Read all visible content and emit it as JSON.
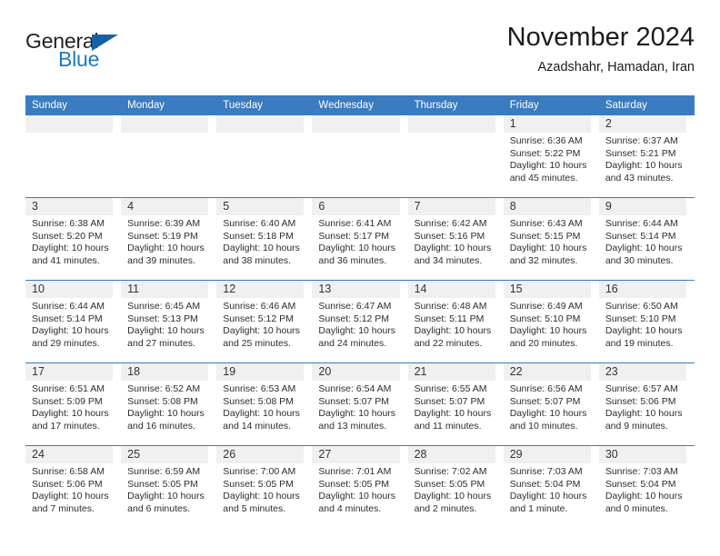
{
  "brand": {
    "name_top": "General",
    "name_bottom": "Blue",
    "triangle_icon": "triangle-icon",
    "color_black": "#231f20",
    "color_blue": "#1b7ac9"
  },
  "header": {
    "title": "November 2024",
    "subtitle": "Azadshahr, Hamadan, Iran"
  },
  "theme": {
    "header_blue": "#3b7bbf",
    "daynum_strip": "#f0f0f0",
    "text": "#2d2d2d"
  },
  "calendar": {
    "weekday_headers": [
      "Sunday",
      "Monday",
      "Tuesday",
      "Wednesday",
      "Thursday",
      "Friday",
      "Saturday"
    ],
    "weeks": [
      [
        {
          "day": "",
          "sunrise": "",
          "sunset": "",
          "daylight_line1": "",
          "daylight_line2": ""
        },
        {
          "day": "",
          "sunrise": "",
          "sunset": "",
          "daylight_line1": "",
          "daylight_line2": ""
        },
        {
          "day": "",
          "sunrise": "",
          "sunset": "",
          "daylight_line1": "",
          "daylight_line2": ""
        },
        {
          "day": "",
          "sunrise": "",
          "sunset": "",
          "daylight_line1": "",
          "daylight_line2": ""
        },
        {
          "day": "",
          "sunrise": "",
          "sunset": "",
          "daylight_line1": "",
          "daylight_line2": ""
        },
        {
          "day": "1",
          "sunrise": "Sunrise: 6:36 AM",
          "sunset": "Sunset: 5:22 PM",
          "daylight_line1": "Daylight: 10 hours",
          "daylight_line2": "and 45 minutes."
        },
        {
          "day": "2",
          "sunrise": "Sunrise: 6:37 AM",
          "sunset": "Sunset: 5:21 PM",
          "daylight_line1": "Daylight: 10 hours",
          "daylight_line2": "and 43 minutes."
        }
      ],
      [
        {
          "day": "3",
          "sunrise": "Sunrise: 6:38 AM",
          "sunset": "Sunset: 5:20 PM",
          "daylight_line1": "Daylight: 10 hours",
          "daylight_line2": "and 41 minutes."
        },
        {
          "day": "4",
          "sunrise": "Sunrise: 6:39 AM",
          "sunset": "Sunset: 5:19 PM",
          "daylight_line1": "Daylight: 10 hours",
          "daylight_line2": "and 39 minutes."
        },
        {
          "day": "5",
          "sunrise": "Sunrise: 6:40 AM",
          "sunset": "Sunset: 5:18 PM",
          "daylight_line1": "Daylight: 10 hours",
          "daylight_line2": "and 38 minutes."
        },
        {
          "day": "6",
          "sunrise": "Sunrise: 6:41 AM",
          "sunset": "Sunset: 5:17 PM",
          "daylight_line1": "Daylight: 10 hours",
          "daylight_line2": "and 36 minutes."
        },
        {
          "day": "7",
          "sunrise": "Sunrise: 6:42 AM",
          "sunset": "Sunset: 5:16 PM",
          "daylight_line1": "Daylight: 10 hours",
          "daylight_line2": "and 34 minutes."
        },
        {
          "day": "8",
          "sunrise": "Sunrise: 6:43 AM",
          "sunset": "Sunset: 5:15 PM",
          "daylight_line1": "Daylight: 10 hours",
          "daylight_line2": "and 32 minutes."
        },
        {
          "day": "9",
          "sunrise": "Sunrise: 6:44 AM",
          "sunset": "Sunset: 5:14 PM",
          "daylight_line1": "Daylight: 10 hours",
          "daylight_line2": "and 30 minutes."
        }
      ],
      [
        {
          "day": "10",
          "sunrise": "Sunrise: 6:44 AM",
          "sunset": "Sunset: 5:14 PM",
          "daylight_line1": "Daylight: 10 hours",
          "daylight_line2": "and 29 minutes."
        },
        {
          "day": "11",
          "sunrise": "Sunrise: 6:45 AM",
          "sunset": "Sunset: 5:13 PM",
          "daylight_line1": "Daylight: 10 hours",
          "daylight_line2": "and 27 minutes."
        },
        {
          "day": "12",
          "sunrise": "Sunrise: 6:46 AM",
          "sunset": "Sunset: 5:12 PM",
          "daylight_line1": "Daylight: 10 hours",
          "daylight_line2": "and 25 minutes."
        },
        {
          "day": "13",
          "sunrise": "Sunrise: 6:47 AM",
          "sunset": "Sunset: 5:12 PM",
          "daylight_line1": "Daylight: 10 hours",
          "daylight_line2": "and 24 minutes."
        },
        {
          "day": "14",
          "sunrise": "Sunrise: 6:48 AM",
          "sunset": "Sunset: 5:11 PM",
          "daylight_line1": "Daylight: 10 hours",
          "daylight_line2": "and 22 minutes."
        },
        {
          "day": "15",
          "sunrise": "Sunrise: 6:49 AM",
          "sunset": "Sunset: 5:10 PM",
          "daylight_line1": "Daylight: 10 hours",
          "daylight_line2": "and 20 minutes."
        },
        {
          "day": "16",
          "sunrise": "Sunrise: 6:50 AM",
          "sunset": "Sunset: 5:10 PM",
          "daylight_line1": "Daylight: 10 hours",
          "daylight_line2": "and 19 minutes."
        }
      ],
      [
        {
          "day": "17",
          "sunrise": "Sunrise: 6:51 AM",
          "sunset": "Sunset: 5:09 PM",
          "daylight_line1": "Daylight: 10 hours",
          "daylight_line2": "and 17 minutes."
        },
        {
          "day": "18",
          "sunrise": "Sunrise: 6:52 AM",
          "sunset": "Sunset: 5:08 PM",
          "daylight_line1": "Daylight: 10 hours",
          "daylight_line2": "and 16 minutes."
        },
        {
          "day": "19",
          "sunrise": "Sunrise: 6:53 AM",
          "sunset": "Sunset: 5:08 PM",
          "daylight_line1": "Daylight: 10 hours",
          "daylight_line2": "and 14 minutes."
        },
        {
          "day": "20",
          "sunrise": "Sunrise: 6:54 AM",
          "sunset": "Sunset: 5:07 PM",
          "daylight_line1": "Daylight: 10 hours",
          "daylight_line2": "and 13 minutes."
        },
        {
          "day": "21",
          "sunrise": "Sunrise: 6:55 AM",
          "sunset": "Sunset: 5:07 PM",
          "daylight_line1": "Daylight: 10 hours",
          "daylight_line2": "and 11 minutes."
        },
        {
          "day": "22",
          "sunrise": "Sunrise: 6:56 AM",
          "sunset": "Sunset: 5:07 PM",
          "daylight_line1": "Daylight: 10 hours",
          "daylight_line2": "and 10 minutes."
        },
        {
          "day": "23",
          "sunrise": "Sunrise: 6:57 AM",
          "sunset": "Sunset: 5:06 PM",
          "daylight_line1": "Daylight: 10 hours",
          "daylight_line2": "and 9 minutes."
        }
      ],
      [
        {
          "day": "24",
          "sunrise": "Sunrise: 6:58 AM",
          "sunset": "Sunset: 5:06 PM",
          "daylight_line1": "Daylight: 10 hours",
          "daylight_line2": "and 7 minutes."
        },
        {
          "day": "25",
          "sunrise": "Sunrise: 6:59 AM",
          "sunset": "Sunset: 5:05 PM",
          "daylight_line1": "Daylight: 10 hours",
          "daylight_line2": "and 6 minutes."
        },
        {
          "day": "26",
          "sunrise": "Sunrise: 7:00 AM",
          "sunset": "Sunset: 5:05 PM",
          "daylight_line1": "Daylight: 10 hours",
          "daylight_line2": "and 5 minutes."
        },
        {
          "day": "27",
          "sunrise": "Sunrise: 7:01 AM",
          "sunset": "Sunset: 5:05 PM",
          "daylight_line1": "Daylight: 10 hours",
          "daylight_line2": "and 4 minutes."
        },
        {
          "day": "28",
          "sunrise": "Sunrise: 7:02 AM",
          "sunset": "Sunset: 5:05 PM",
          "daylight_line1": "Daylight: 10 hours",
          "daylight_line2": "and 2 minutes."
        },
        {
          "day": "29",
          "sunrise": "Sunrise: 7:03 AM",
          "sunset": "Sunset: 5:04 PM",
          "daylight_line1": "Daylight: 10 hours",
          "daylight_line2": "and 1 minute."
        },
        {
          "day": "30",
          "sunrise": "Sunrise: 7:03 AM",
          "sunset": "Sunset: 5:04 PM",
          "daylight_line1": "Daylight: 10 hours",
          "daylight_line2": "and 0 minutes."
        }
      ]
    ]
  }
}
